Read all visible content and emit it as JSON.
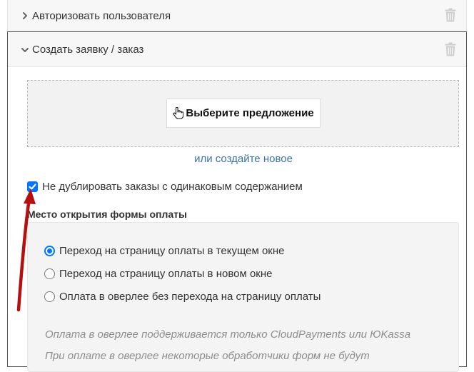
{
  "panels": {
    "authorize": {
      "title": "Авторизовать пользователя"
    },
    "create_order": {
      "title": "Создать заявку / заказ",
      "offer_button_label": "Выберите предложение",
      "create_new_link": "или создайте новое",
      "no_duplicate_label": "Не дублировать заказы с одинаковым содержанием",
      "no_duplicate_checked": true,
      "payment_section_title": "Место открытия формы оплаты",
      "payment_options": [
        {
          "label": "Переход на страницу оплаты в текущем окне",
          "selected": true
        },
        {
          "label": "Переход на страницу оплаты в новом окне",
          "selected": false
        },
        {
          "label": "Оплата в оверлее без перехода на страницу оплаты",
          "selected": false
        }
      ],
      "notes": [
        "Оплата в оверлее поддерживается только CloudPayments или ЮKassa",
        "При оплате в оверлее некоторые обработчики форм не будут"
      ]
    }
  },
  "colors": {
    "accent": "#0075ff",
    "link": "#3a74a8",
    "arrow": "#b50f0f",
    "note_text": "#8d8d8d"
  },
  "icons": {
    "collapsed_chevron": "chevron-right-icon",
    "expanded_chevron": "chevron-down-icon",
    "delete": "trash-icon",
    "offer_button": "hand-pointer-icon"
  }
}
